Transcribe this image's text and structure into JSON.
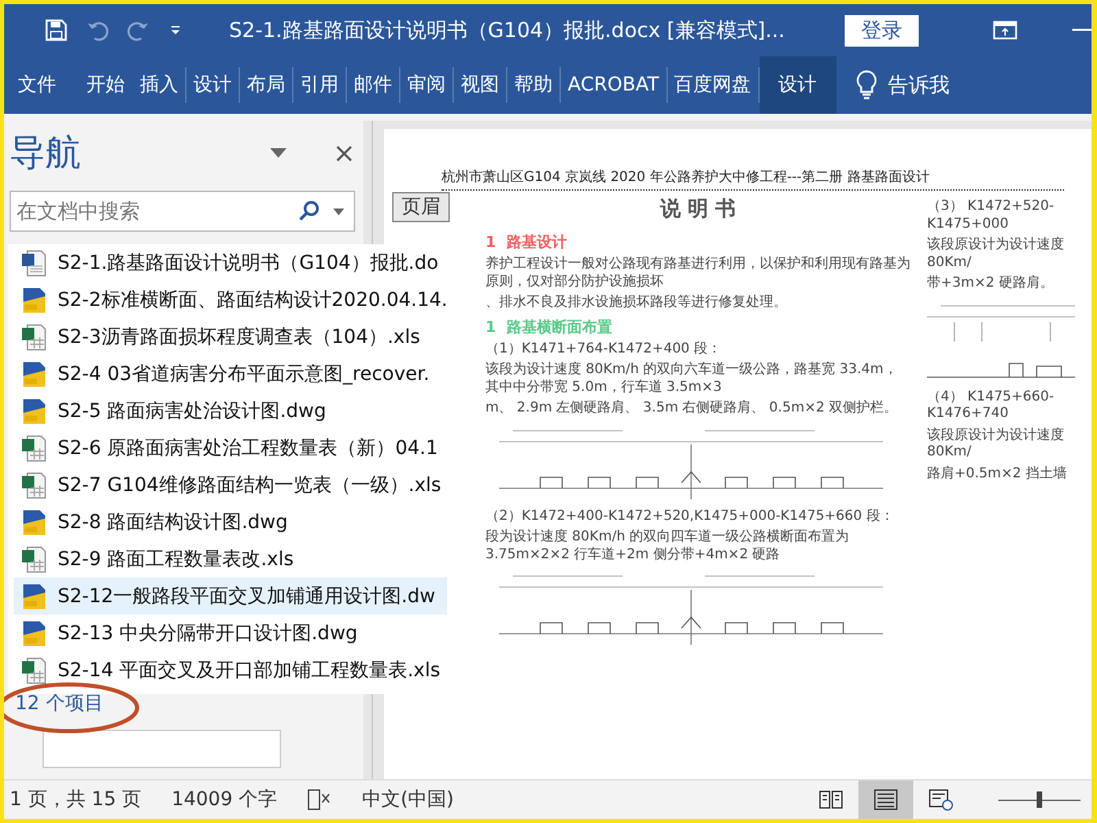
{
  "title_bar": {
    "title": "S2-1.路基路面设计说明书（G104）报批.docx [兼容模式]...",
    "sign_in": "登录"
  },
  "ribbon": {
    "tabs": [
      {
        "label": "文件",
        "selected": false
      },
      {
        "label": "开始",
        "selected": false
      },
      {
        "label": "插入",
        "selected": false
      },
      {
        "label": "设计",
        "selected": false
      },
      {
        "label": "布局",
        "selected": false
      },
      {
        "label": "引用",
        "selected": false
      },
      {
        "label": "邮件",
        "selected": false
      },
      {
        "label": "审阅",
        "selected": false
      },
      {
        "label": "视图",
        "selected": false
      },
      {
        "label": "帮助",
        "selected": false
      },
      {
        "label": "ACROBAT",
        "selected": false
      },
      {
        "label": "百度网盘",
        "selected": false
      },
      {
        "label": "设计",
        "selected": true
      }
    ],
    "tell_me": "告诉我"
  },
  "navigation": {
    "title": "导航",
    "search": {
      "placeholder": "在文档中搜索"
    },
    "item_count": "12 个项目"
  },
  "file_list": [
    {
      "kind": "word",
      "name": "S2-1.路基路面设计说明书（G104）报批.do",
      "selected": false
    },
    {
      "kind": "dwg",
      "name": "S2-2标准横断面、路面结构设计2020.04.14.",
      "selected": false
    },
    {
      "kind": "xls",
      "name": "S2-3沥青路面损坏程度调查表（104）.xls",
      "selected": false
    },
    {
      "kind": "dwg",
      "name": "S2-4  03省道病害分布平面示意图_recover.",
      "selected": false
    },
    {
      "kind": "dwg",
      "name": "S2-5 路面病害处治设计图.dwg",
      "selected": false
    },
    {
      "kind": "xls",
      "name": "S2-6 原路面病害处治工程数量表（新）04.1",
      "selected": false
    },
    {
      "kind": "xls",
      "name": "S2-7 G104维修路面结构一览表（一级）.xls",
      "selected": false
    },
    {
      "kind": "dwg",
      "name": "S2-8 路面结构设计图.dwg",
      "selected": false
    },
    {
      "kind": "xls",
      "name": "S2-9 路面工程数量表改.xls",
      "selected": false
    },
    {
      "kind": "dwg",
      "name": "S2-12一般路段平面交叉加铺通用设计图.dw",
      "selected": true
    },
    {
      "kind": "dwg",
      "name": "S2-13 中央分隔带开口设计图.dwg",
      "selected": false
    },
    {
      "kind": "xls",
      "name": "S2-14 平面交叉及开口部加铺工程数量表.xls",
      "selected": false
    }
  ],
  "document": {
    "header_tag": "页眉",
    "header": "杭州市萧山区G104 京岚线 2020 年公路养护大中修工程---第二册 路基路面设计",
    "title": "说 明 书",
    "main": [
      {
        "kind": "h1",
        "number": "1",
        "text": "路基设计"
      },
      {
        "kind": "para",
        "text": "养护工程设计一般对公路现有路基进行利用，以保护和利用现有路基为原则，仅对部分防护设施损坏"
      },
      {
        "kind": "para",
        "text": "、排水不良及排水设施损坏路段等进行修复处理。"
      },
      {
        "kind": "h2",
        "number": "1",
        "text": "路基横断面布置"
      },
      {
        "kind": "para",
        "text": "（1）K1471+764-K1472+400 段："
      },
      {
        "kind": "para",
        "text": "该段为设计速度 80Km/h 的双向六车道一级公路，路基宽 33.4m，其中中分带宽 5.0m，行车道 3.5m×3"
      },
      {
        "kind": "para",
        "text": "m、 2.9m 左侧硬路肩、 3.5m 右侧硬路肩、 0.5m×2 双侧护栏。"
      },
      {
        "kind": "drawing"
      },
      {
        "kind": "para",
        "text": "（2）K1472+400-K1472+520,K1475+000-K1475+660 段："
      },
      {
        "kind": "para",
        "text": "段为设计速度 80Km/h 的双向四车道一级公路横断面布置为 3.75m×2×2 行车道+2m 侧分带+4m×2 硬路"
      },
      {
        "kind": "drawing"
      }
    ],
    "side": [
      {
        "kind": "para",
        "text": "（3） K1472+520-K1475+000"
      },
      {
        "kind": "para",
        "text": "该段原设计为设计速度 80Km/"
      },
      {
        "kind": "para",
        "text": "带+3m×2 硬路肩。"
      },
      {
        "kind": "drawing"
      },
      {
        "kind": "para",
        "text": "（4） K1475+660-K1476+740"
      },
      {
        "kind": "para",
        "text": "该段原设计为设计速度 80Km/"
      },
      {
        "kind": "para",
        "text": "路肩+0.5m×2 挡土墙"
      }
    ]
  },
  "status_bar": {
    "page": "1 页，共 15 页",
    "words": "14009 个字",
    "language": "中文(中国)",
    "views": [
      {
        "kind": "read",
        "selected": false
      },
      {
        "kind": "print",
        "selected": true
      },
      {
        "kind": "web",
        "selected": false
      }
    ],
    "zoom": {
      "level": 0.5
    }
  }
}
